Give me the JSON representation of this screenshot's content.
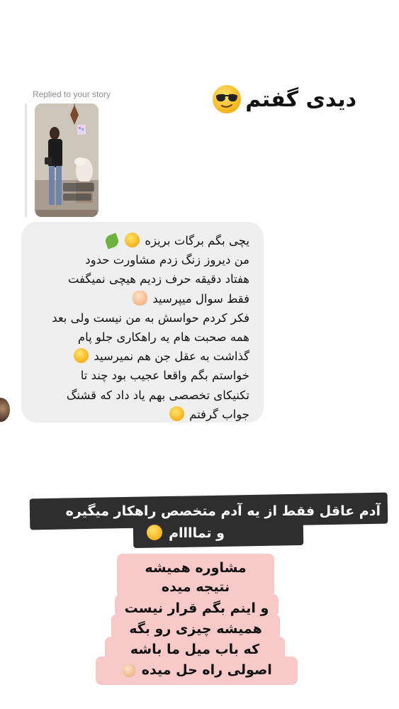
{
  "reply_label": "Replied to your story",
  "title_sticker": {
    "text": "دیدی گفتم",
    "emoji": "sunglasses-face"
  },
  "message": {
    "lines": [
      "یچی بگم برگات بریزه",
      "من دیروز زنگ زدم مشاورت حدود",
      "هفتاد دقیقه حرف زدیم هیچی نمیگفت",
      "فقط سوال میپرسید",
      "فکر کردم حواسش به من نیست ولی بعد",
      "همه صحبت هام یه راهکاری جلو پام",
      "گذاشت به عقل جن هم نمیرسید",
      "خواستم بگم واقعا عجیب بود چند تا",
      "تکنیکای تخصصی بهم یاد داد که قشنگ",
      "جواب گرفتم"
    ]
  },
  "caption_dark": {
    "line1": "آدم عاقل فقط از یه آدم متخصص راهکار میگیره",
    "line2": "و تماااام"
  },
  "caption_pink": {
    "lines": [
      "مشاوره همیشه",
      "نتیجه میده",
      "و اینم بگم قرار نیست",
      "همیشه چیزی رو بگه",
      "که باب میل ما باشه",
      "اصولی راه حل میده"
    ]
  },
  "colors": {
    "bubble": "#efefef",
    "dark_band": "#2e2e2e",
    "pink_band": "#f7c9c9",
    "muted": "#8e8e8e"
  }
}
